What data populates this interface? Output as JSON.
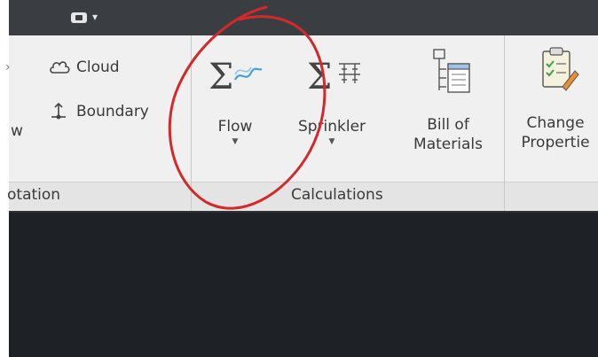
{
  "ribbon": {
    "left_edge_label": "w",
    "annotation_panel": {
      "title": "otation",
      "cloud_label": "Cloud",
      "boundary_label": "Boundary"
    },
    "calculations_panel": {
      "title": "Calculations",
      "flow_label": "Flow",
      "sprinkler_label": "Sprinkler",
      "bill_line1": "Bill of",
      "bill_line2": "Materials"
    },
    "change_line1": "Change",
    "change_line2": "Propertie"
  },
  "colors": {
    "ribbon_bg": "#f0f0f0",
    "topbar_bg": "#3a3d42",
    "canvas_bg": "#1e2126",
    "annotation_circle": "#d22a2a",
    "flow_icon_blue": "#4a9fd8"
  }
}
